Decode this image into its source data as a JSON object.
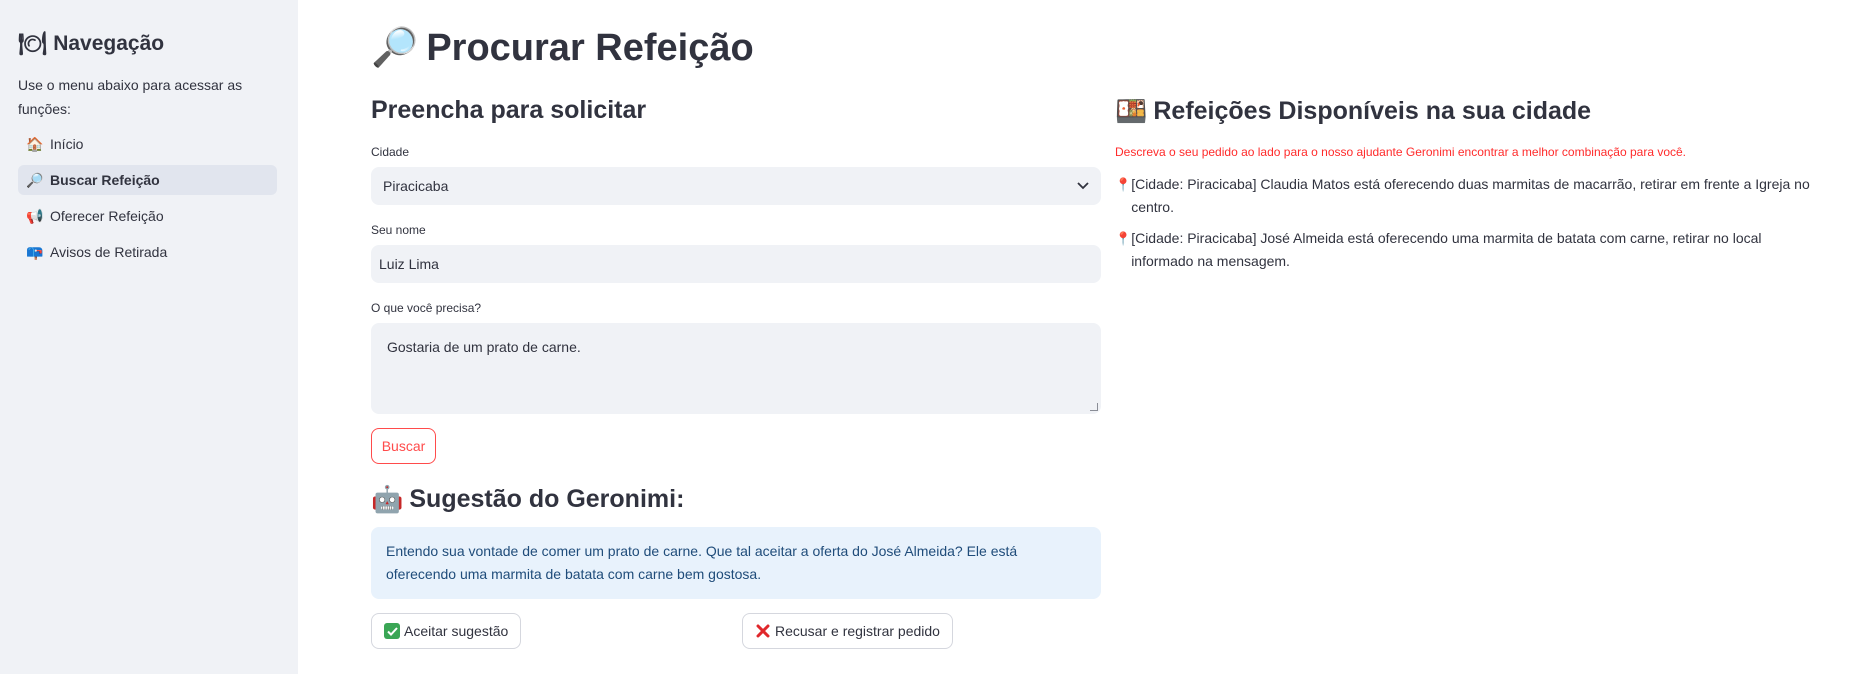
{
  "sidebar": {
    "title": "Navegação",
    "title_icon": "plate-icon",
    "description": "Use o menu abaixo para acessar as funções:",
    "items": [
      {
        "label": "Início",
        "icon": "house-icon",
        "glyph": "🏠",
        "active": false
      },
      {
        "label": "Buscar Refeição",
        "icon": "magnifier-icon",
        "glyph": "🔎",
        "active": true
      },
      {
        "label": "Oferecer Refeição",
        "icon": "megaphone-icon",
        "glyph": "📢",
        "active": false
      },
      {
        "label": "Avisos de Retirada",
        "icon": "mailbox-icon",
        "glyph": "📪",
        "active": false
      }
    ]
  },
  "page": {
    "title": "Procurar Refeição",
    "title_icon": "magnifier-icon"
  },
  "form": {
    "heading": "Preencha para solicitar",
    "city_label": "Cidade",
    "city_value": "Piracicaba",
    "name_label": "Seu nome",
    "name_value": "Luiz Lima",
    "need_label": "O que você precisa?",
    "need_value": "Gostaria de um prato de carne.",
    "search_button": "Buscar"
  },
  "suggestion": {
    "heading": "Sugestão do Geronimi:",
    "icon": "robot-icon",
    "text": "Entendo sua vontade de comer um prato de carne. Que tal aceitar a oferta do José Almeida? Ele está oferecendo uma marmita de batata com carne bem gostosa.",
    "accept_label": "Aceitar sugestão",
    "reject_label": "Recusar e registrar pedido"
  },
  "available": {
    "heading": "Refeições Disponíveis na sua cidade",
    "icon": "bento-box-icon",
    "hint": "Descreva o seu pedido ao lado para o nosso ajudante Geronimi encontrar a melhor combinação para você.",
    "offers": [
      "[Cidade: Piracicaba] Claudia Matos está oferecendo duas marmitas de macarrão, retirar em frente a Igreja no centro.",
      "[Cidade: Piracicaba] José Almeida está oferecendo uma marmita de batata com carne, retirar no local informado na mensagem."
    ]
  },
  "colors": {
    "sidebar_bg": "#f0f2f6",
    "accent_red": "#ff4b4b",
    "info_bg": "#e8f2fc",
    "info_text": "#1f4c7a",
    "text": "#31333f"
  }
}
